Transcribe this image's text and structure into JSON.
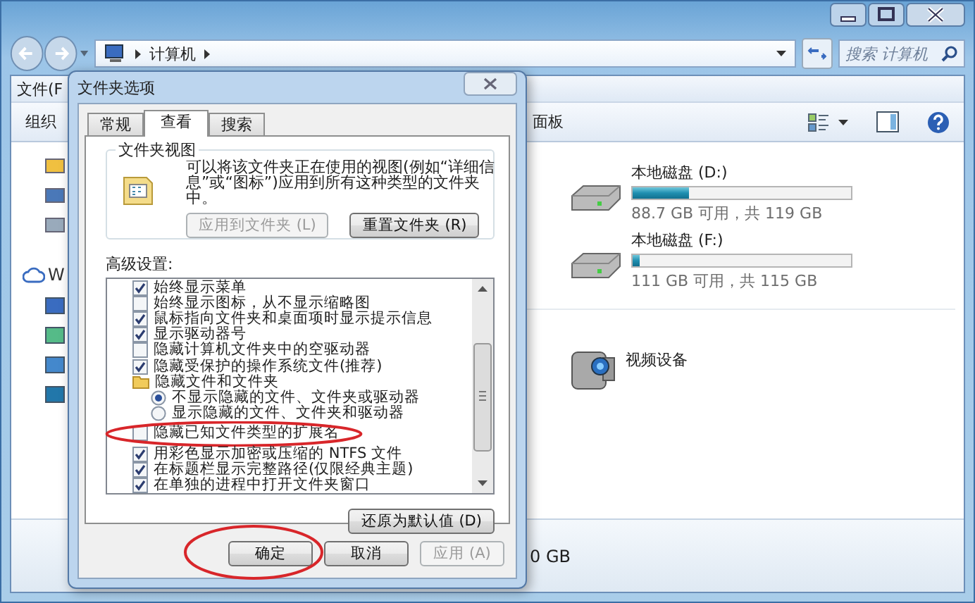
{
  "explorer": {
    "address_path": "计算机",
    "search": {
      "placeholder": "搜索 计算机"
    },
    "menu": [
      "文件(F"
    ],
    "toolbar": [
      "组织",
      "面板"
    ],
    "nav_items": [
      "W"
    ],
    "drives": [
      {
        "name": "本地磁盘 (D:)",
        "level": 0.26,
        "free": "88.7 GB 可用，共 119 GB"
      },
      {
        "name": "本地磁盘 (F:)",
        "level": 0.03,
        "free": "111 GB 可用，共 115 GB"
      }
    ],
    "devices": [
      {
        "name": "视频设备"
      }
    ],
    "status_text": "0 GB"
  },
  "dialog": {
    "title": "文件夹选项",
    "tabs": [
      {
        "label": "常规",
        "selected": false
      },
      {
        "label": "查看",
        "selected": true
      },
      {
        "label": "搜索",
        "selected": false
      }
    ],
    "folder_views": {
      "title": "文件夹视图",
      "description": "可以将该文件夹正在使用的视图(例如“详细信息”或“图标”)应用到所有这种类型的文件夹中。",
      "buttons": [
        {
          "label": "应用到文件夹 (L)",
          "disabled": true
        },
        {
          "label": "重置文件夹 (R)",
          "disabled": false
        }
      ]
    },
    "advanced_label": "高级设置:",
    "settings": [
      {
        "kind": "checkbox",
        "label": "始终显示菜单",
        "checked": true,
        "highlighted": false
      },
      {
        "kind": "checkbox",
        "label": "始终显示图标，从不显示缩略图",
        "checked": false,
        "highlighted": false
      },
      {
        "kind": "checkbox",
        "label": "鼠标指向文件夹和桌面项时显示提示信息",
        "checked": true,
        "highlighted": false
      },
      {
        "kind": "checkbox",
        "label": "显示驱动器号",
        "checked": true,
        "highlighted": false
      },
      {
        "kind": "checkbox",
        "label": "隐藏计算机文件夹中的空驱动器",
        "checked": false,
        "highlighted": false
      },
      {
        "kind": "checkbox",
        "label": "隐藏受保护的操作系统文件(推荐)",
        "checked": true,
        "highlighted": false
      },
      {
        "kind": "group",
        "label": "隐藏文件和文件夹",
        "highlighted": false,
        "children": [
          {
            "label": "不显示隐藏的文件、文件夹或驱动器",
            "selected": true
          },
          {
            "label": "显示隐藏的文件、文件夹和驱动器",
            "selected": false
          }
        ]
      },
      {
        "kind": "checkbox",
        "label": "隐藏已知文件类型的扩展名",
        "checked": false,
        "highlighted": true
      },
      {
        "kind": "checkbox",
        "label": "用彩色显示加密或压缩的 NTFS 文件",
        "checked": true,
        "highlighted": false
      },
      {
        "kind": "checkbox",
        "label": "在标题栏显示完整路径(仅限经典主题)",
        "checked": true,
        "highlighted": false
      },
      {
        "kind": "checkbox",
        "label": "在单独的进程中打开文件夹窗口",
        "checked": true,
        "highlighted": false
      }
    ],
    "restore_button": "还原为默认值 (D)",
    "buttons": [
      {
        "label": "确定",
        "disabled": false,
        "highlighted": true
      },
      {
        "label": "取消",
        "disabled": false,
        "highlighted": false
      },
      {
        "label": "应用 (A)",
        "disabled": true,
        "highlighted": false
      }
    ]
  }
}
